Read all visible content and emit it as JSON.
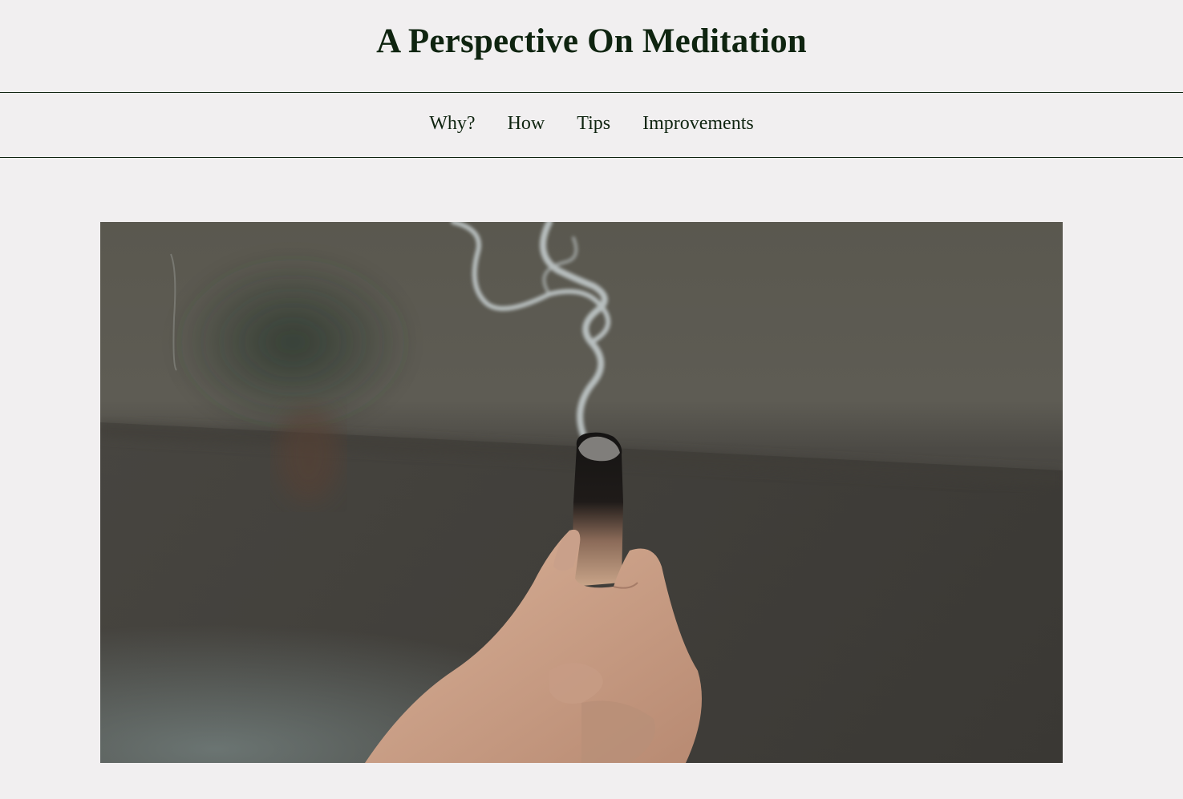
{
  "header": {
    "title": "A Perspective On Meditation"
  },
  "nav": {
    "items": [
      {
        "label": "Why?"
      },
      {
        "label": "How"
      },
      {
        "label": "Tips"
      },
      {
        "label": "Improvements"
      }
    ]
  },
  "hero": {
    "image_subject": "hand holding a smoking palo santo stick"
  },
  "colors": {
    "background": "#f1eff0",
    "text": "#0f2410",
    "divider": "#0f2410"
  }
}
